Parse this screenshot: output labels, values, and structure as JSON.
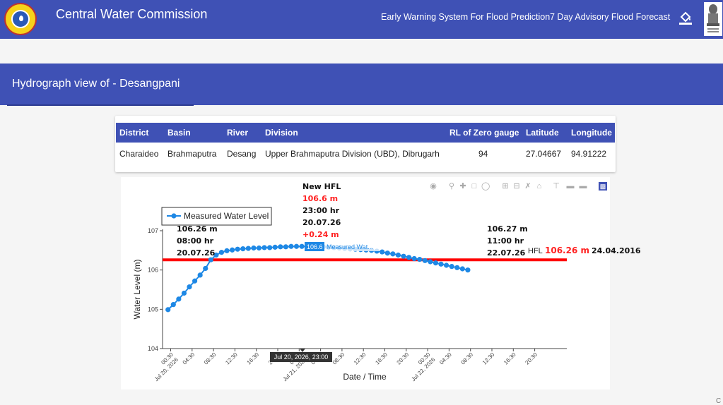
{
  "header": {
    "title": "Central Water Commission",
    "nav": [
      "Early Warning System For Flood Prediction",
      "7 Day Advisory Flood Forecast"
    ]
  },
  "section": {
    "title": "Hydrograph view of - Desangpani"
  },
  "station_table": {
    "headers": [
      "District",
      "Basin",
      "River",
      "Division",
      "RL of Zero gauge",
      "Latitude",
      "Longitude"
    ],
    "row": [
      "Charaideo",
      "Brahmaputra",
      "Desang",
      "Upper Brahmaputra Division (UBD), Dibrugarh",
      "94",
      "27.04667",
      "94.91222"
    ]
  },
  "colors": {
    "header_bg": "#3f51b5",
    "series": "#1e88e5",
    "hfl_line": "#ff0000",
    "hfl_text": "#ff2222"
  },
  "chart_data": {
    "type": "line",
    "legend": [
      "Measured Water Level"
    ],
    "legend_position": "top-left",
    "xlabel": "Date / Time",
    "ylabel": "Water Level (m)",
    "ylim": [
      104,
      107
    ],
    "yticks": [
      "104",
      "105",
      "106",
      "107"
    ],
    "xticks": [
      [
        "00:30",
        "Jul 20, 2026"
      ],
      [
        "04:30",
        ""
      ],
      [
        "08:30",
        ""
      ],
      [
        "12:30",
        ""
      ],
      [
        "16:30",
        ""
      ],
      [
        "20:30",
        ""
      ],
      [
        "00:30",
        "Jul 21, 2026"
      ],
      [
        "04:30",
        ""
      ],
      [
        "08:30",
        ""
      ],
      [
        "12:30",
        ""
      ],
      [
        "16:30",
        ""
      ],
      [
        "20:30",
        ""
      ],
      [
        "00:30",
        "Jul 22, 2026"
      ],
      [
        "04:30",
        ""
      ],
      [
        "08:30",
        ""
      ],
      [
        "12:30",
        ""
      ],
      [
        "16:30",
        ""
      ],
      [
        "20:30",
        ""
      ]
    ],
    "series": [
      {
        "name": "Measured Water Level",
        "x_start": "2026-07-20 00:00",
        "interval_hours": 1,
        "values": [
          104.99,
          105.12,
          105.26,
          105.41,
          105.57,
          105.72,
          105.87,
          106.04,
          106.26,
          106.38,
          106.45,
          106.49,
          106.51,
          106.53,
          106.54,
          106.55,
          106.56,
          106.56,
          106.57,
          106.57,
          106.58,
          106.59,
          106.59,
          106.6,
          106.6,
          106.6,
          106.6,
          106.6,
          106.59,
          106.59,
          106.58,
          106.57,
          106.56,
          106.55,
          106.54,
          106.53,
          106.52,
          106.51,
          106.5,
          106.48,
          106.46,
          106.43,
          106.41,
          106.38,
          106.35,
          106.32,
          106.29,
          106.27,
          106.24,
          106.21,
          106.18,
          106.15,
          106.12,
          106.09,
          106.06,
          106.03,
          106.0
        ]
      }
    ],
    "hfl": {
      "label": "HFL",
      "value_text": "106.26 m",
      "date": "24.04.2016",
      "level": 106.26
    },
    "annotations": {
      "start": [
        "106.26 m",
        "08:00 hr",
        "20.07.26"
      ],
      "new_hfl": {
        "title": "New HFL",
        "value": "106.6 m",
        "time": "23:00 hr",
        "date": "20.07.26",
        "rise": "+0.24 m"
      },
      "later": [
        "106.27 m",
        "11:00 hr",
        "22.07.26"
      ]
    },
    "hover": {
      "value": "106.6",
      "series_name": "Measured Wat...",
      "x_label": "Jul 20, 2026, 23:00"
    }
  }
}
